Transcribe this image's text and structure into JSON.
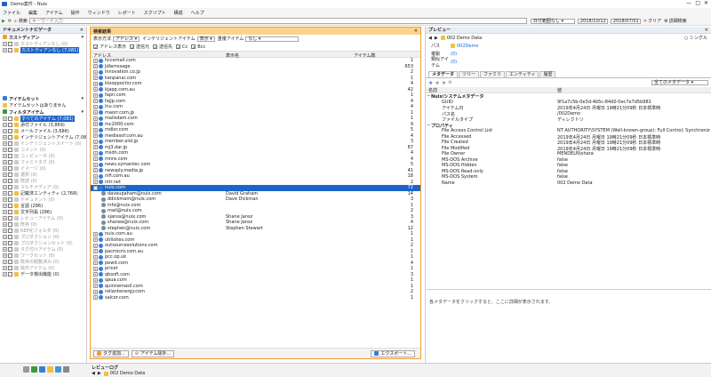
{
  "window": {
    "title": "Demo案件 - Nuix"
  },
  "menu": [
    "ファイル",
    "編集",
    "アイテム",
    "操作",
    "ウィンドウ",
    "レポート",
    "スクリプト",
    "構成",
    "ヘルプ"
  ],
  "toolbar": {
    "search_label": "検索",
    "search_placeholder": "キーワード入力",
    "date_label": "日付範囲なし",
    "date_from": "2018/10/12",
    "date_to": "2018/07/01",
    "clear_label": "クリア",
    "advanced_label": "詳細検索"
  },
  "left": {
    "doc_nav_title": "ドキュメントナビゲータ",
    "custodian_title": "カストディアン",
    "custodian_items": [
      {
        "label": "カストディアンなし",
        "count": "(0)",
        "dim": true
      },
      {
        "label": "カストディアンなし",
        "count": "(7,081)",
        "selected": true
      }
    ],
    "itemset_title": "アイテムセット",
    "itemset_items": [
      {
        "label": "アイテムセットはありません",
        "dim": false
      }
    ],
    "filter_title": "フィルタアイテム",
    "filter_items": [
      {
        "label": "すべてのアイテム",
        "count": "(7,081)",
        "selected": true
      },
      {
        "label": "添付ファイル",
        "count": "(3,869)",
        "dim": false
      },
      {
        "label": "メールファイル",
        "count": "(3,686)",
        "dim": false
      },
      {
        "label": "インテリジェントアイテム",
        "count": "(7,081)",
        "dim": false
      },
      {
        "label": "インテリジェントスイート",
        "count": "(0)",
        "dim": true
      },
      {
        "label": "コメント",
        "count": "(0)",
        "dim": true
      },
      {
        "label": "コンピュータ",
        "count": "(0)",
        "dim": true
      },
      {
        "label": "ファミリタグ",
        "count": "(0)",
        "dim": true
      },
      {
        "label": "イメージ",
        "count": "(0)",
        "dim": true
      },
      {
        "label": "選択",
        "count": "(0)",
        "dim": true
      },
      {
        "label": "既読",
        "count": "(0)",
        "dim": true
      },
      {
        "label": "マルチメディア",
        "count": "(0)",
        "dim": true
      },
      {
        "label": "記載済エンティティ",
        "count": "(2,768)",
        "dim": false
      },
      {
        "label": "ドキュメント",
        "count": "(0)",
        "dim": true
      },
      {
        "label": "言語",
        "count": "(286)",
        "dim": false
      },
      {
        "label": "文字列長",
        "count": "(286)",
        "dim": false
      },
      {
        "label": "レビューアイテム",
        "count": "(0)",
        "dim": true
      },
      {
        "label": "既存",
        "count": "(0)",
        "dim": true
      },
      {
        "label": "REP化フォルダ",
        "count": "(0)",
        "dim": true
      },
      {
        "label": "プロダクション",
        "count": "(0)",
        "dim": true
      },
      {
        "label": "プロダクションセット",
        "count": "(0)",
        "dim": true
      },
      {
        "label": "タグ付けアイテム",
        "count": "(0)",
        "dim": true
      },
      {
        "label": "ワークセット",
        "count": "(0)",
        "dim": true
      },
      {
        "label": "既存の閲覧済み",
        "count": "(0)",
        "dim": true
      },
      {
        "label": "除外アイテム",
        "count": "(0)",
        "dim": true
      },
      {
        "label": "データ検出機能",
        "count": "(0)",
        "dim": false
      }
    ]
  },
  "center": {
    "title": "検索結果",
    "view_label": "表示方法",
    "view_value": "アドレス",
    "select_label": "インテリジェントアイテム",
    "select_value": "表示",
    "dup_label": "重複アイテム",
    "dup_value": "なし",
    "filters": [
      "アドレス表示",
      "送信元",
      "送信先",
      "Cc",
      "Bcc"
    ],
    "columns": {
      "address": "アドレス",
      "name": "表示名",
      "count": "アイテム数"
    },
    "rows": [
      {
        "address": "hccemail.com",
        "name": "",
        "count": "1"
      },
      {
        "address": "Jdlemssage",
        "name": "",
        "count": "653"
      },
      {
        "address": "innovation.co.jp",
        "name": "",
        "count": "2"
      },
      {
        "address": "kanpanai.com",
        "name": "",
        "count": "1"
      },
      {
        "address": "klooppoctor.com",
        "name": "",
        "count": "4"
      },
      {
        "address": "kjapp.com.au",
        "name": "",
        "count": "42"
      },
      {
        "address": "fapn.com",
        "name": "",
        "count": "1"
      },
      {
        "address": "fajjp.com",
        "name": "",
        "count": "4"
      },
      {
        "address": "lnu.com",
        "name": "",
        "count": "4"
      },
      {
        "address": "maorr.com.jp",
        "name": "",
        "count": "1"
      },
      {
        "address": "mailsdam.com",
        "name": "",
        "count": "1"
      },
      {
        "address": "mc2000.com",
        "name": "",
        "count": "9"
      },
      {
        "address": "mdlor.com",
        "name": "",
        "count": "5"
      },
      {
        "address": "mediasof.com.au",
        "name": "",
        "count": "4"
      },
      {
        "address": "member.aiol.jp",
        "name": "",
        "count": "3"
      },
      {
        "address": "mj3.dar.jp",
        "name": "",
        "count": "67"
      },
      {
        "address": "msdn.com",
        "name": "",
        "count": "4"
      },
      {
        "address": "mnre.com",
        "name": "",
        "count": "4"
      },
      {
        "address": "news.symantec.com",
        "name": "",
        "count": "5"
      },
      {
        "address": "newsply.media.jp",
        "name": "",
        "count": "41"
      },
      {
        "address": "nifi.com.au",
        "name": "",
        "count": "18"
      },
      {
        "address": "nitr.net",
        "name": "",
        "count": "2"
      },
      {
        "address": "nuix.com",
        "name": "",
        "count": "72",
        "selected": true
      },
      {
        "address": "daveupaham@nuix.com",
        "name": "David Graham",
        "count": "14",
        "child": true
      },
      {
        "address": "ddickmam@nuix.com",
        "name": "Dave Dickman",
        "count": "3",
        "child": true
      },
      {
        "address": "info@nuix.com",
        "name": "",
        "count": "1",
        "child": true
      },
      {
        "address": "mail@nuix.com",
        "name": "",
        "count": "2",
        "child": true
      },
      {
        "address": "sjanss@nuix.com",
        "name": "Shane Jansz",
        "count": "3",
        "child": true
      },
      {
        "address": "shanee@nuix.com",
        "name": "Shane Jansz",
        "count": "4",
        "child": true
      },
      {
        "address": "stephen@nuix.com",
        "name": "Stephen Stewart",
        "count": "12",
        "child": true
      },
      {
        "address": "nuix.com.au",
        "name": "",
        "count": "1"
      },
      {
        "address": "utilisites.com",
        "name": "",
        "count": "1"
      },
      {
        "address": "outsourcesolutions.com",
        "name": "",
        "count": "2"
      },
      {
        "address": "pacmicro.com.au",
        "name": "",
        "count": "1"
      },
      {
        "address": "pcc.op.uk",
        "name": "",
        "count": "1"
      },
      {
        "address": "pewit.com",
        "name": "",
        "count": "4"
      },
      {
        "address": "pricet",
        "name": "",
        "count": "1"
      },
      {
        "address": "qbsoft.com",
        "name": "",
        "count": "3"
      },
      {
        "address": "qaua.com",
        "name": "",
        "count": "1"
      },
      {
        "address": "quinnemasil.com",
        "name": "",
        "count": "1"
      },
      {
        "address": "reliantenergy.com",
        "name": "",
        "count": "2"
      },
      {
        "address": "salcor.com",
        "name": "",
        "count": "1"
      }
    ],
    "btn_add_tag": "タグ追加...",
    "btn_remove": "アイテム除外...",
    "btn_export": "エクスポート..."
  },
  "right": {
    "title": "プレビュー",
    "item_name": "002 Demo Data",
    "single_label": "シングル",
    "path_label": "パス",
    "path_value": "002Demo",
    "tag_label": "複製",
    "tag_value": "(0)",
    "related_label": "類似アイテム",
    "related_value": "(0)",
    "tabs": [
      "メタデータ",
      "ツリー",
      "ファミリ",
      "エンティティ",
      "履歴"
    ],
    "metadata_filter": "全てのメタデータ",
    "col_key": "名前",
    "col_value": "値",
    "meta": [
      {
        "k": "Nuix/システムメタデータ",
        "v": "",
        "grp": true
      },
      {
        "k": "GUID",
        "v": "9f1a7c5b-0e3d-4b5c-84d0-0ec7e7d5b981"
      },
      {
        "k": "アイテム日",
        "v": "2019年4月24日 月曜日 19時21分09秒 日本標準時"
      },
      {
        "k": "パス名",
        "v": "/002Demo"
      },
      {
        "k": "ファイルタイプ",
        "v": "ディレクトリ"
      },
      {
        "k": "プロパティ",
        "v": "",
        "grp": true
      },
      {
        "k": "File Access Control List",
        "v": "NT AUTHORITY\\SYSTEM (Well-known-group): Full Control; Synchronize..."
      },
      {
        "k": "File Accessed",
        "v": "2019年4月24日 月曜日 19時21分09秒 日本標準時"
      },
      {
        "k": "File Created",
        "v": "2019年4月24日 月曜日 19時21分09秒 日本標準時"
      },
      {
        "k": "File Modified",
        "v": "2019年4月24日 月曜日 19時21分09秒 日本標準時"
      },
      {
        "k": "File Owner",
        "v": "MENDELN\\ohara"
      },
      {
        "k": "MS-DOS Archive",
        "v": "false"
      },
      {
        "k": "MS-DOS Hidden",
        "v": "false"
      },
      {
        "k": "MS-DOS Read-only",
        "v": "false"
      },
      {
        "k": "MS-DOS System",
        "v": "false"
      },
      {
        "k": "Name",
        "v": "002 Demo Data"
      }
    ],
    "hint": "各メタデータをクリックすると、ここに詳細が表示されます。"
  },
  "bottom": {
    "review_title": "レビューログ",
    "item": "002 Demo Data"
  },
  "colors": {
    "accent": "#1e64c8",
    "panel_header": "#fdd28a",
    "tag_icon": "#f0a030"
  }
}
